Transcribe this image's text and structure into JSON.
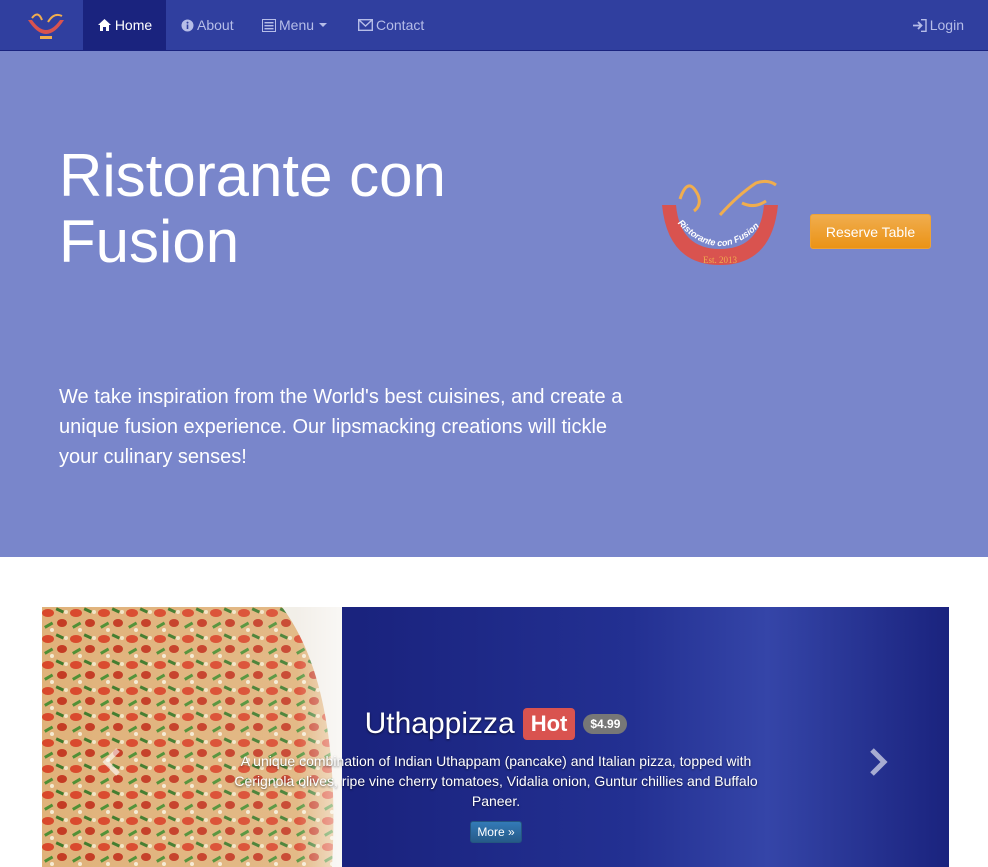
{
  "nav": {
    "home": "Home",
    "about": "About",
    "menu": "Menu",
    "contact": "Contact",
    "login": "Login"
  },
  "jumbotron": {
    "title": "Ristorante con Fusion",
    "description": "We take inspiration from the World's best cuisines, and create a unique fusion experience. Our lipsmacking creations will tickle your culinary senses!",
    "reserve_label": "Reserve Table",
    "logo_text": "Ristorante con Fusion",
    "logo_est": "Est. 2013"
  },
  "carousel": {
    "dish_name": "Uthappizza",
    "hot_label": "Hot",
    "price": "$4.99",
    "description": "A unique combination of Indian Uthappam (pancake) and Italian pizza, topped with Cerignola olives, ripe vine cherry tomatoes, Vidalia onion, Guntur chillies and Buffalo Paneer.",
    "more_label": "More »"
  },
  "colors": {
    "navbar": "#303f9f",
    "navbar_active": "#1a237e",
    "jumbotron": "#7986cb",
    "reserve_button": "#f0ad4e",
    "hot_badge": "#d9534f",
    "price_badge": "#777777",
    "more_button": "#337ab7"
  },
  "icons": {
    "home": "home-icon",
    "about": "info-circle-icon",
    "menu": "list-alt-icon",
    "contact": "envelope-icon",
    "login": "log-in-icon"
  }
}
